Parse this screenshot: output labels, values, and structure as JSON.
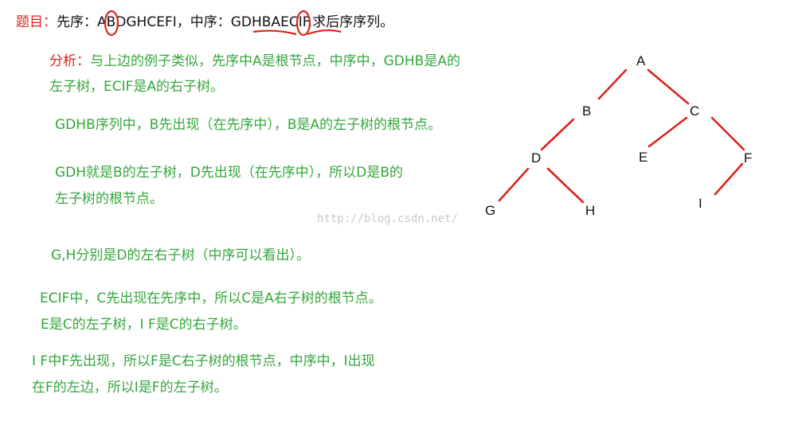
{
  "header": {
    "prefix": "题目：",
    "preorder_label": "先序：",
    "preorder_value": "ABDGHCEFI",
    "sep": "，",
    "inorder_label": "中序：",
    "inorder_left": "GDHB",
    "inorder_root": "A",
    "inorder_right": "ECIF",
    "task": ".求后序序列。"
  },
  "analysis": {
    "label": "分析：",
    "line1": "与上边的例子类似，先序中A是根节点，中序中，GDHB是A的",
    "line2": "左子树，ECIF是A的右子树。"
  },
  "steps": [
    "GDHB序列中，B先出现（在先序中），B是A的左子树的根节点。",
    "GDH就是B的左子树，D先出现（在先序中），所以D是B的",
    "左子树的根节点。",
    "G,H分别是D的左右子树（中序可以看出）。",
    "ECIF中，C先出现在先序中，所以C是A右子树的根节点。",
    "E是C的左子树，I F是C的右子树。",
    "I F中F先出现，所以F是C右子树的根节点，中序中，I出现",
    "在F的左边，所以I是F的左子树。"
  ],
  "tree": {
    "nodes": [
      "A",
      "B",
      "C",
      "D",
      "E",
      "F",
      "G",
      "H",
      "I"
    ],
    "edges": [
      [
        "A",
        "B"
      ],
      [
        "A",
        "C"
      ],
      [
        "B",
        "D"
      ],
      [
        "C",
        "E"
      ],
      [
        "C",
        "F"
      ],
      [
        "D",
        "G"
      ],
      [
        "D",
        "H"
      ],
      [
        "F",
        "I"
      ]
    ]
  },
  "watermark": "http://blog.csdn.net/",
  "colors": {
    "heading": "#d9251d",
    "text": "#111111",
    "analysis": "#33a63b",
    "edge": "#d9251d"
  }
}
